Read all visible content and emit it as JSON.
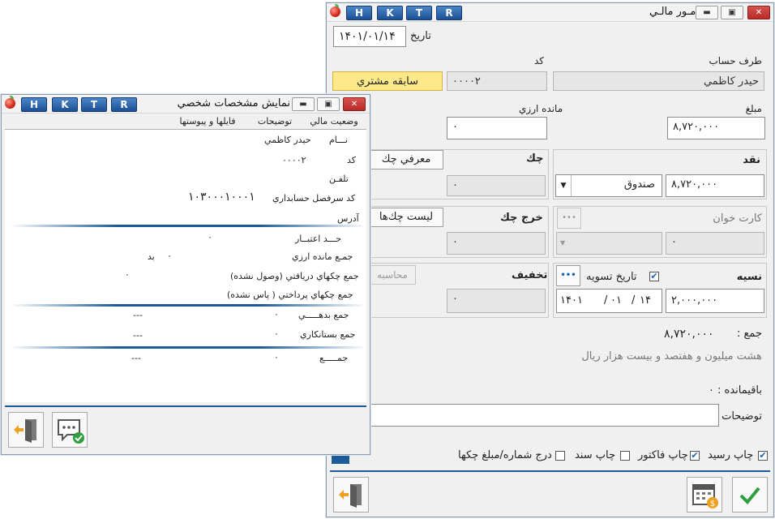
{
  "main_window": {
    "title": "امـور مالـي",
    "hk_buttons": [
      "H",
      "K",
      "T",
      "R"
    ],
    "date_label": "تاريخ",
    "date_value": "۱۴۰۱/۰۱/۱۴",
    "party_label": "طرف حساب",
    "party_value": "حيدر كاظمي",
    "code_label": "كد",
    "code_value": "۰۰۰۰۲",
    "history_button": "سابقه مشتري",
    "amount_label": "مبلغ",
    "amount_value": "۸,۷۲۰,۰۰۰",
    "fx_remaining_label": "مانده ارزي",
    "fx_remaining_value": "۰",
    "cash": {
      "label": "نقد",
      "fund": "صندوق",
      "value": "۸,۷۲۰,۰۰۰"
    },
    "cheque": {
      "label": "چك",
      "intro_button": "معرفي چك",
      "value": "۰"
    },
    "card_reader": {
      "label": "كارت خوان",
      "value": "۰",
      "more": "•••"
    },
    "cheque_out": {
      "label": "خرج چك",
      "list_button": "ليست چك‌ها",
      "value": "۰"
    },
    "credit": {
      "label": "نسيه",
      "settle_date_label": "تاريخ تسويه",
      "settle_checked": true,
      "more": "•••",
      "date_y": "۱۴۰۱",
      "date_m": "۰۱",
      "date_d": "۱۴",
      "value": "۲,۰۰۰,۰۰۰"
    },
    "discount": {
      "label": "تخفيف",
      "calc_button": "محاسبه",
      "value": "۰"
    },
    "total_label": "جمع :",
    "total_value": "۸,۷۲۰,۰۰۰",
    "total_words": "هشت ميليون  و هفتصد و بيست هزار  ريال",
    "balance_label": "باقيمانده :",
    "balance_value": "۰",
    "notes_label": "توضيحات",
    "notes_value": "",
    "options": [
      {
        "label": "چاپ رسيد",
        "checked": true
      },
      {
        "label": "چاپ فاكتور",
        "checked": true
      },
      {
        "label": "چاپ سند",
        "checked": false
      },
      {
        "label": "درج شماره/مبلغ چكها",
        "checked": false
      }
    ]
  },
  "person_window": {
    "title": "نمايش مشخصات شخصي",
    "hk_buttons": [
      "H",
      "K",
      "T",
      "R"
    ],
    "tabs": [
      "وضعيت مالي",
      "توضيحات",
      "فايلها و پيوستها"
    ],
    "rows": {
      "name_label": "نـــام",
      "name_value": "حيدر كاظمي",
      "code_label": "كد",
      "code_value": "۰۰۰۰۲",
      "phone_label": "تلفـن",
      "ledger_label": "كد سرفصل حسابداري",
      "ledger_value": "۱۰۳۰۰۰۱۰۰۰۱",
      "address_label": "آدرس",
      "credit_label": "حـــد اعتبــار",
      "credit_value": "۰",
      "fx_label": "جمـع مانده ارزي",
      "fx_value": "۰",
      "fx_suffix": "بد",
      "recv_label": "جمع چكهاي دريافتي (وصول نشده)",
      "recv_value": "۰",
      "paid_label": "جمع چكهاي پرداختي ( پاس نشده)",
      "debit_label": "جمع بدهـــــي",
      "debit_value": "۰",
      "debit_dash": "---",
      "creditor_label": "جمع بستانكاري",
      "creditor_value": "۰",
      "creditor_dash": "---",
      "sum_label": "جمـــــع",
      "sum_value": "۰",
      "sum_dash": "---"
    }
  },
  "colors": {
    "accent_blue": "#1b5b99",
    "history_yellow": "#fde98a",
    "ok_green": "#2e9e3f",
    "exit_orange": "#f0a020"
  }
}
